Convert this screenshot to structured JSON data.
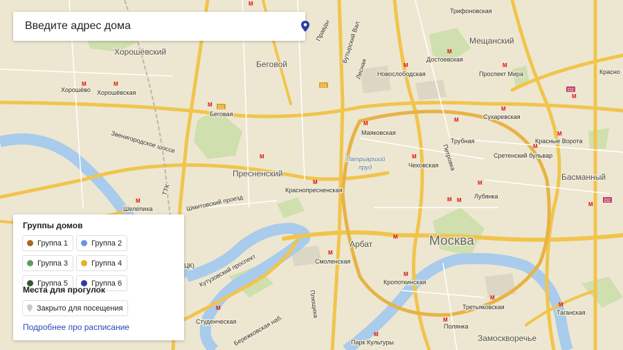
{
  "search": {
    "placeholder": "Введите адрес дома"
  },
  "legend": {
    "groups_title": "Группы домов",
    "groups": [
      {
        "label": "Группа 1",
        "color": "#a8691f"
      },
      {
        "label": "Группа 2",
        "color": "#6a95e0"
      },
      {
        "label": "Группа 3",
        "color": "#5a9e5c"
      },
      {
        "label": "Группа 4",
        "color": "#e0b12c"
      },
      {
        "label": "Группа 5",
        "color": "#2f5a2e"
      },
      {
        "label": "Группа 6",
        "color": "#2a3ca6"
      }
    ],
    "walks_title": "Места для прогулок",
    "closed_label": "Закрыто для посещения",
    "more_link": "Подробнее про расписание"
  },
  "map": {
    "districts": [
      "Хорошёвский",
      "Беговой",
      "Пресненский",
      "Арбат",
      "Мещанский",
      "Басманный",
      "Замоскворечье"
    ],
    "city": "Москва",
    "pond": [
      "Патриарший",
      "пруд"
    ],
    "stations": [
      "Хорошёво",
      "Хорошёвская",
      "Беговая",
      "Шелепиха",
      "Краснопресненская",
      "Маяковская",
      "Чеховская",
      "Новослободская",
      "Достоевская",
      "Проспект Мира",
      "Сухаревская",
      "Трубная",
      "Сретенский бульвар",
      "Красные Ворота",
      "Лубянка",
      "Смоленская",
      "Кропоткинская",
      "Студенческая",
      "Парк Культуры",
      "Полянка",
      "Третьяковская",
      "Таганская",
      "Трифоновская",
      "Красно",
      "ЦК)"
    ],
    "streets": [
      "Звенигородское шоссе",
      "Шмитовский проезд",
      "Кутузовский проспект",
      "Бутырский Вал",
      "Лесная",
      "Правды",
      "Петровка",
      "Плющиха",
      "Бережковская наб.",
      "ТТК"
    ],
    "routes": [
      "D1",
      "D1",
      "D2",
      "D2"
    ]
  },
  "colors": {
    "accent": "#2b47b8",
    "pin": "#2a3ca6",
    "road": "#f3c64a",
    "water": "#a6c8e8",
    "park": "#c8dcaa"
  }
}
